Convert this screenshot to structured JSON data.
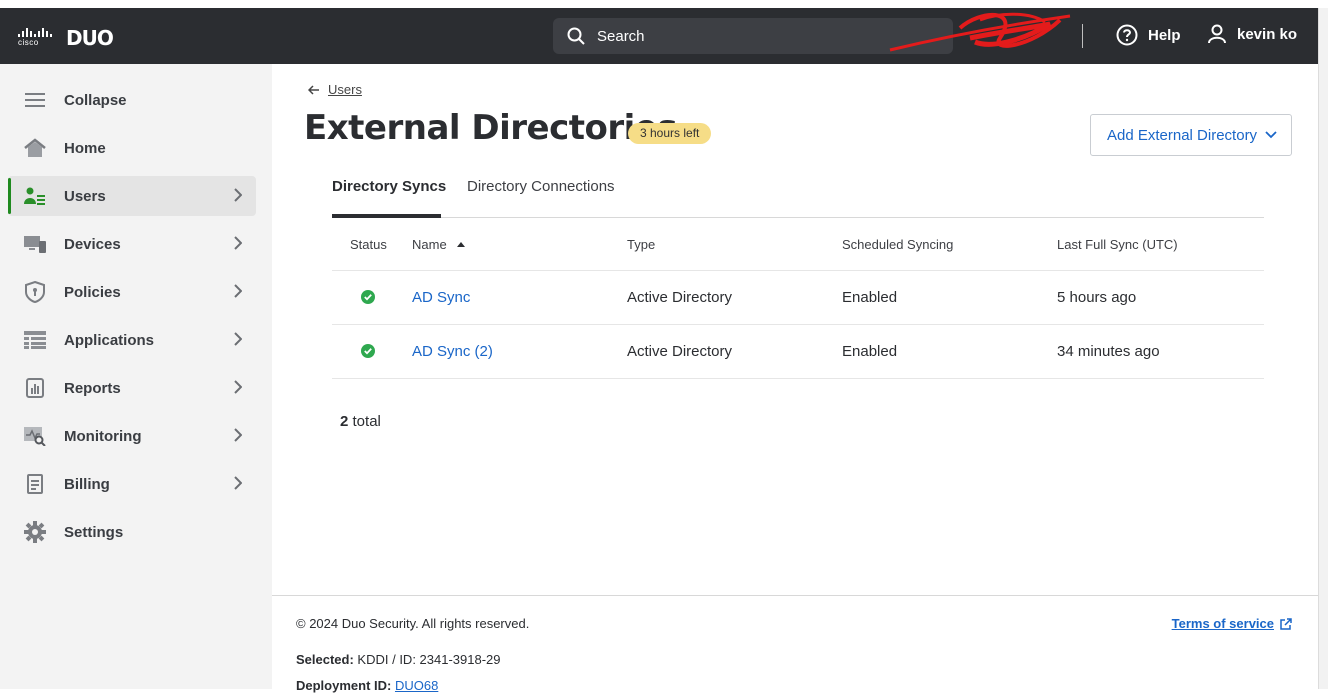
{
  "header": {
    "brand_cisco": "cisco",
    "brand_duo": "DUO",
    "search_placeholder": "Search",
    "help_label": "Help",
    "user_name": "kevin ko"
  },
  "sidebar": {
    "items": [
      {
        "label": "Collapse",
        "icon": "hamburger-icon"
      },
      {
        "label": "Home",
        "icon": "home-icon"
      },
      {
        "label": "Users",
        "icon": "users-icon",
        "active": true
      },
      {
        "label": "Devices",
        "icon": "devices-icon"
      },
      {
        "label": "Policies",
        "icon": "shield-icon"
      },
      {
        "label": "Applications",
        "icon": "applications-icon"
      },
      {
        "label": "Reports",
        "icon": "reports-icon"
      },
      {
        "label": "Monitoring",
        "icon": "monitoring-icon"
      },
      {
        "label": "Billing",
        "icon": "billing-icon"
      },
      {
        "label": "Settings",
        "icon": "gear-icon"
      }
    ]
  },
  "page": {
    "breadcrumb": "Users",
    "title": "External Directories",
    "badge": "3 hours left",
    "add_button": "Add External Directory"
  },
  "tabs": [
    {
      "label": "Directory Syncs",
      "active": true
    },
    {
      "label": "Directory Connections",
      "active": false
    }
  ],
  "table": {
    "columns": [
      "Status",
      "Name",
      "Type",
      "Scheduled Syncing",
      "Last Full Sync (UTC)"
    ],
    "rows": [
      {
        "status": "ok",
        "name": "AD Sync",
        "type": "Active Directory",
        "scheduled": "Enabled",
        "last_sync": "5 hours ago"
      },
      {
        "status": "ok",
        "name": "AD Sync (2)",
        "type": "Active Directory",
        "scheduled": "Enabled",
        "last_sync": "34 minutes ago"
      }
    ],
    "total_count": "2",
    "total_suffix": " total"
  },
  "footer": {
    "copyright": "© 2024 Duo Security. All rights reserved.",
    "terms": "Terms of service",
    "selected_label": "Selected:",
    "selected_value": " KDDI / ID: 2341-3918-29",
    "deployment_label": "Deployment ID:",
    "deployment_value": "DUO68"
  },
  "colors": {
    "topbar": "#2b2d31",
    "accent_link": "#1a66c8",
    "active_indicator": "#1f8a1f",
    "status_ok": "#2fa84f",
    "badge_bg": "#f6dd87"
  }
}
